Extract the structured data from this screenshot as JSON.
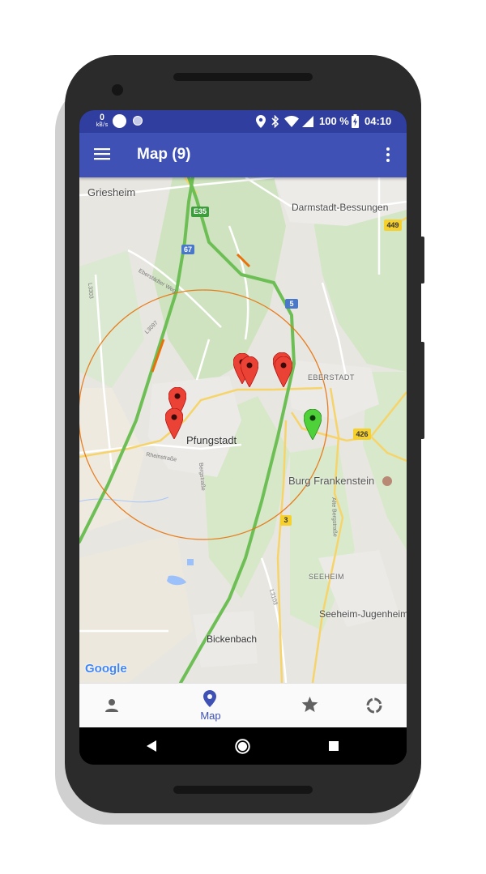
{
  "status_bar": {
    "net_speed_value": "0",
    "net_speed_unit": "kB/s",
    "battery_percent": "100 %",
    "time": "04:10"
  },
  "app_bar": {
    "title": "Map (9)"
  },
  "map": {
    "places": {
      "griesheim": "Griesheim",
      "darmstadt_bessungen": "Darmstadt-Bessungen",
      "eberstadt": "EBERSTADT",
      "pfungstadt": "Pfungstadt",
      "burg_frankenstein": "Burg Frankenstein",
      "seeheim": "SEEHEIM",
      "seeheim_jugenheim": "Seeheim-Jugenheim",
      "bickenbach": "Bickenbach"
    },
    "streets": {
      "eberstaedter_weg": "Eberstädter Weg",
      "rheinstrasse": "Rheinstraße",
      "bergstrasse": "Bergstraße",
      "alte_bergstrasse": "Alte Bergstraße",
      "l3303": "L3303",
      "l3097": "L3097",
      "l3103": "L3103"
    },
    "road_shields": {
      "e35": "E35",
      "a67": "67",
      "a5": "5",
      "b449": "449",
      "b426": "426",
      "b3": "3"
    },
    "logo": "Google",
    "colors": {
      "radius_circle": "#e8710a",
      "marker_default": "#ea4335",
      "marker_current": "#34a853"
    }
  },
  "bottom_nav": {
    "items": [
      {
        "icon": "person-icon",
        "label": ""
      },
      {
        "icon": "map-pin-icon",
        "label": "Map"
      },
      {
        "icon": "star-icon",
        "label": ""
      },
      {
        "icon": "progress-ring-icon",
        "label": ""
      }
    ],
    "active_color": "#3f51b5"
  }
}
